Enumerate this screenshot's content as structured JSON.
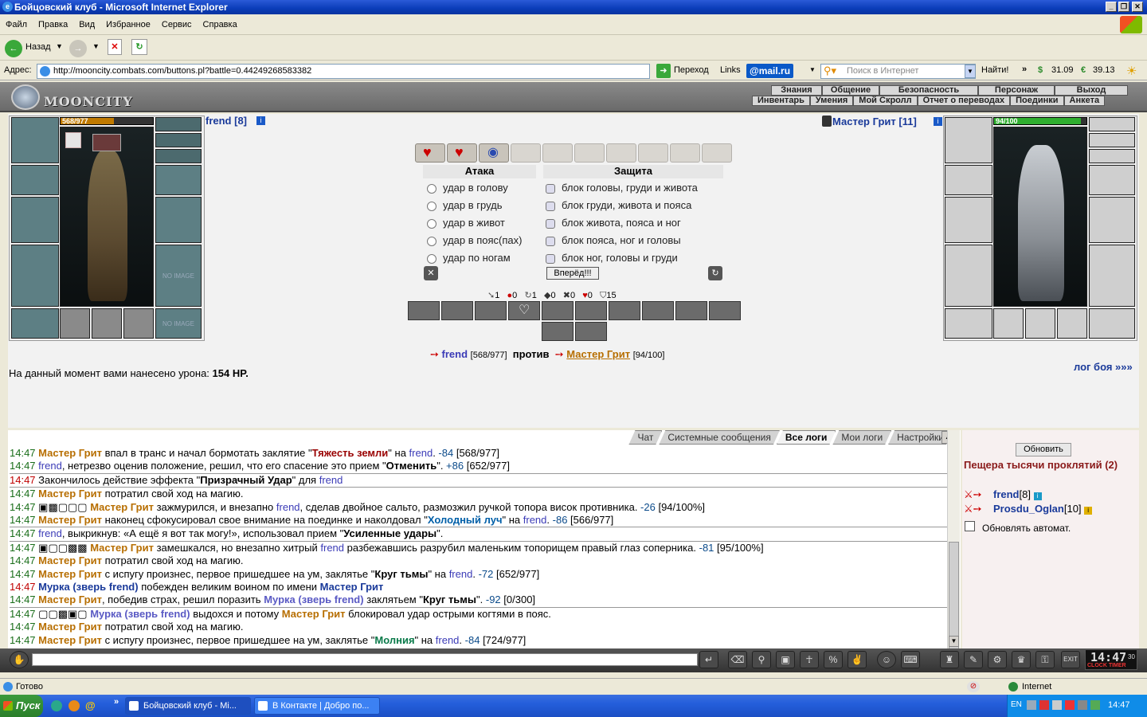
{
  "window": {
    "title": "Бойцовский клуб - Microsoft Internet Explorer"
  },
  "menu": [
    "Файл",
    "Правка",
    "Вид",
    "Избранное",
    "Сервис",
    "Справка"
  ],
  "toolbar": {
    "back": "Назад"
  },
  "address": {
    "label": "Адрес:",
    "url": "http://mooncity.combats.com/buttons.pl?battle=0.44249268583382",
    "go": "Переход",
    "links": "Links",
    "mailru": "@mail.ru",
    "search_placeholder": "Поиск в Интернет",
    "find": "Найти!",
    "usd": "31.09",
    "eur": "39.13"
  },
  "game": {
    "logo": "MOONCITY",
    "nav_top": [
      "Знания",
      "Общение",
      "Безопасность",
      "Персонаж",
      "Выход"
    ],
    "nav_bottom": [
      "Инвентарь",
      "Умения",
      "Мой Скролл",
      "Отчет о переводах",
      "Поединки",
      "Анкета"
    ]
  },
  "player": {
    "name": "frend [8]",
    "hp": "568/977",
    "hp_ratio": 0.58,
    "no_image": "NO IMAGE"
  },
  "opponent": {
    "name": "Мастер Грит [11]",
    "hp": "94/100",
    "hp_ratio": 0.94
  },
  "battle": {
    "attack_title": "Атака",
    "defense_title": "Защита",
    "attacks": [
      "удар в голову",
      "удар в грудь",
      "удар в живот",
      "удар в пояс(пах)",
      "удар по ногам"
    ],
    "blocks": [
      "блок головы, груди и живота",
      "блок груди, живота и пояса",
      "блок живота, пояса и ног",
      "блок пояса, ног и головы",
      "блок ног, головы и груди"
    ],
    "go_button": "Вперёд!!!",
    "counters": [
      "1",
      "0",
      "1",
      "0",
      "0",
      "0",
      "15"
    ],
    "vs_player": "frend",
    "vs_player_hp": "[568/977]",
    "vs_word": "против",
    "vs_opponent": "Мастер Грит",
    "vs_opponent_hp": "[94/100]",
    "damage_label": "На данный момент вами нанесено урона:",
    "damage_value": "154 HP.",
    "log_link": "лог боя »»»"
  },
  "chat": {
    "tabs": [
      "Чат",
      "Системные сообщения",
      "Все логи",
      "Мои логи",
      "Настройки"
    ],
    "active_tab": 2
  },
  "side": {
    "refresh": "Обновить",
    "location": "Пещера тысячи проклятий (2)",
    "users": [
      "frend",
      "[8]",
      "Prosdu_Oglan",
      "[10]"
    ],
    "auto": "Обновлять автомат."
  },
  "clock": {
    "time": "14:47",
    "sec": "30",
    "labels": "CLOCK TIMER"
  },
  "status": {
    "text": "Готово",
    "zone": "Internet"
  },
  "taskbar": {
    "start": "Пуск",
    "tasks": [
      "Бойцовский клуб - Mi...",
      "В Контакте | Добро по..."
    ],
    "lang": "EN",
    "time": "14:47"
  },
  "colors": {
    "accent": "#0a3cb8",
    "hp_player": "#c07a00",
    "hp_opponent": "#2fae2f"
  }
}
